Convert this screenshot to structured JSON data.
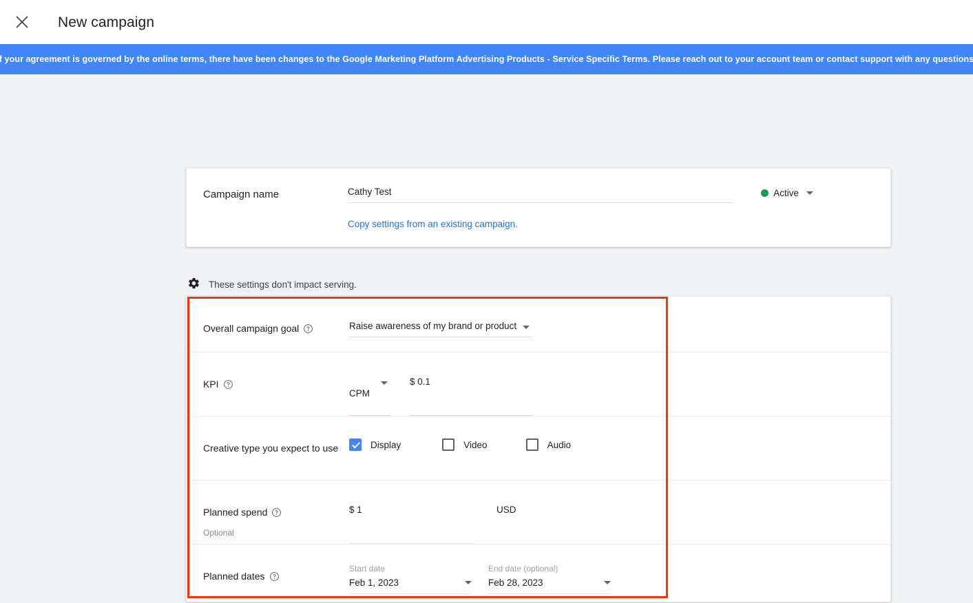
{
  "topbar": {
    "close_icon": "close-icon",
    "title": "New campaign"
  },
  "banner": {
    "text": "If your agreement is governed by the online terms, there have been changes to the Google Marketing Platform Advertising Products - Service Specific Terms. Please reach out to your account team or contact support with any questions.",
    "background_color": "#4285f4",
    "text_color": "#ffffff"
  },
  "campaign_card": {
    "label": "Campaign name",
    "name_value": "Cathy Test",
    "name_placeholder": "Campaign name",
    "copy_link": "Copy settings from an existing campaign.",
    "link_color": "#1a73e8",
    "status": {
      "label": "Active",
      "dot_color": "#0f9d58",
      "caret_icon": "chevron-down-icon"
    }
  },
  "settings_note": {
    "icon": "gear-icon",
    "text": "These settings don't impact serving."
  },
  "settings_card": {
    "rows": [
      {
        "label": "Overall campaign goal",
        "help_icon": "help-circle-icon",
        "goal_value": "Raise awareness of my brand or product",
        "caret_icon": "chevron-down-icon"
      },
      {
        "label": "KPI",
        "help_icon": "help-circle-icon",
        "kpi_type": "CPM",
        "kpi_caret_icon": "chevron-down-icon",
        "kpi_value": "$ 0.1"
      },
      {
        "label": "Creative type you expect to use",
        "options": [
          {
            "label": "Display",
            "checked": true
          },
          {
            "label": "Video",
            "checked": false
          },
          {
            "label": "Audio",
            "checked": false
          }
        ],
        "checked_color": "#4285f4"
      },
      {
        "label": "Planned spend",
        "sub_label": "Optional",
        "help_icon": "help-circle-icon",
        "spend_value": "$ 1",
        "currency": "USD"
      },
      {
        "label": "Planned dates",
        "help_icon": "help-circle-icon",
        "start_caption": "Start date",
        "start_value": "Feb 1, 2023",
        "end_caption": "End date (optional)",
        "end_value": "Feb 28, 2023",
        "caret_icon": "chevron-down-icon"
      }
    ]
  },
  "annotation": {
    "outline_color": "#f4350a"
  }
}
